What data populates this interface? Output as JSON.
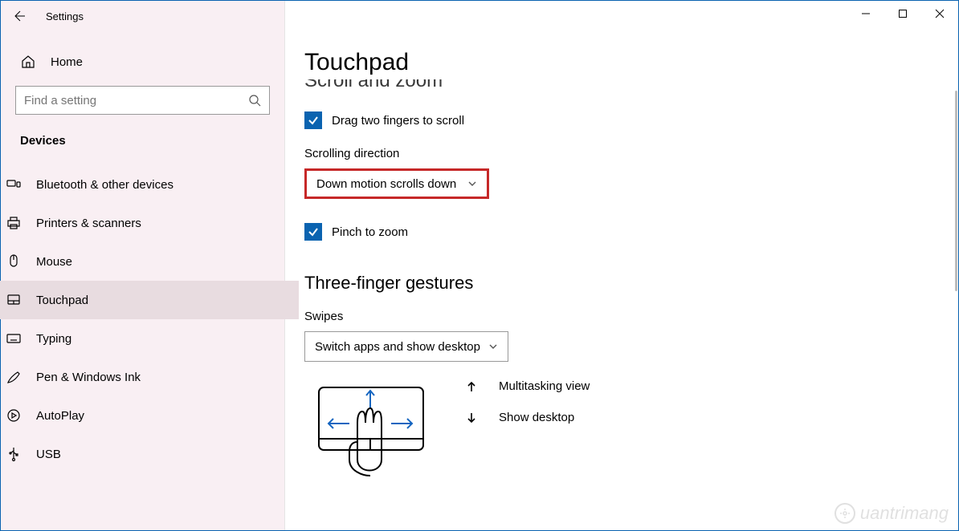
{
  "title": "Settings",
  "window_controls": {
    "min": "minimize",
    "max": "maximize",
    "close": "close"
  },
  "sidebar": {
    "home": "Home",
    "search_placeholder": "Find a setting",
    "section": "Devices",
    "items": [
      {
        "icon": "bluetooth",
        "label": "Bluetooth & other devices"
      },
      {
        "icon": "printer",
        "label": "Printers & scanners"
      },
      {
        "icon": "mouse",
        "label": "Mouse"
      },
      {
        "icon": "touchpad",
        "label": "Touchpad"
      },
      {
        "icon": "keyboard",
        "label": "Typing"
      },
      {
        "icon": "pen",
        "label": "Pen & Windows Ink"
      },
      {
        "icon": "autoplay",
        "label": "AutoPlay"
      },
      {
        "icon": "usb",
        "label": "USB"
      }
    ]
  },
  "main": {
    "title": "Touchpad",
    "partial_heading": "Scroll and zoom",
    "drag_two_fingers": "Drag two fingers to scroll",
    "scrolling_direction_label": "Scrolling direction",
    "scrolling_direction_value": "Down motion scrolls down",
    "pinch_to_zoom": "Pinch to zoom",
    "three_finger_heading": "Three-finger gestures",
    "swipes_label": "Swipes",
    "swipes_value": "Switch apps and show desktop",
    "legend": {
      "up": "Multitasking view",
      "down": "Show desktop"
    }
  },
  "watermark": "uantrimang"
}
